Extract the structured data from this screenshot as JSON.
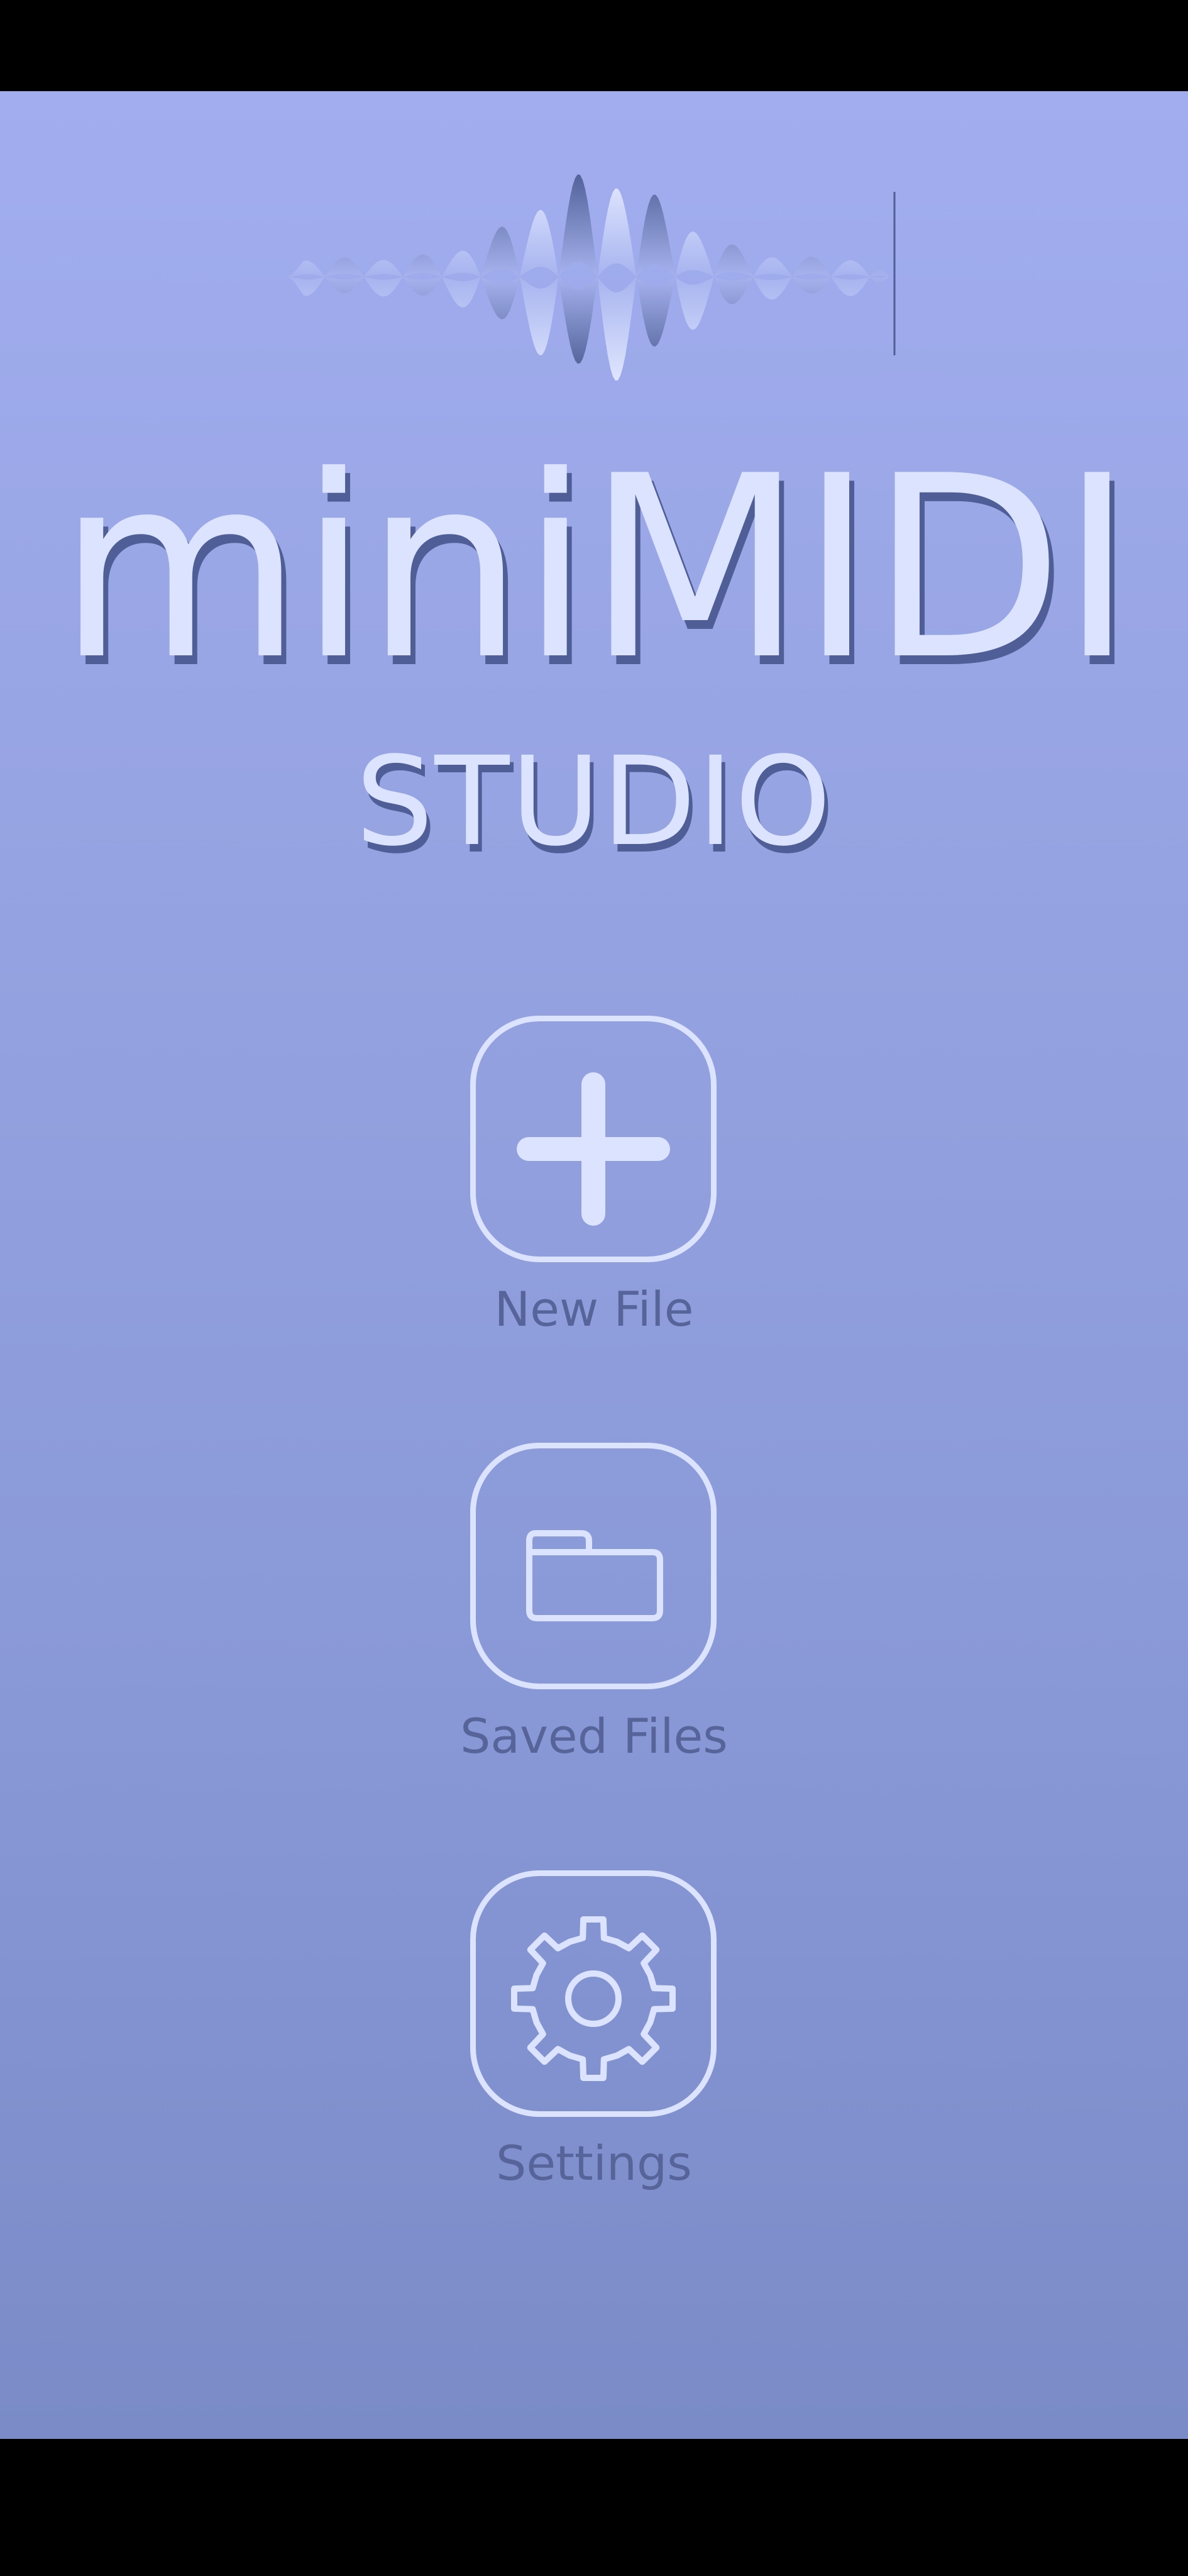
{
  "app": {
    "title": "miniMIDI",
    "subtitle": "STUDIO"
  },
  "menu": {
    "items": [
      {
        "id": "new-file",
        "label": "New File",
        "icon": "plus-icon"
      },
      {
        "id": "saved-files",
        "label": "Saved Files",
        "icon": "folder-icon"
      },
      {
        "id": "settings",
        "label": "Settings",
        "icon": "gear-icon"
      }
    ]
  },
  "colors": {
    "background_top": "#a1adef",
    "background_bottom": "#7a8bc8",
    "foreground": "#dbe3ff",
    "label": "#56649a",
    "shadow": "#4f5e96"
  }
}
